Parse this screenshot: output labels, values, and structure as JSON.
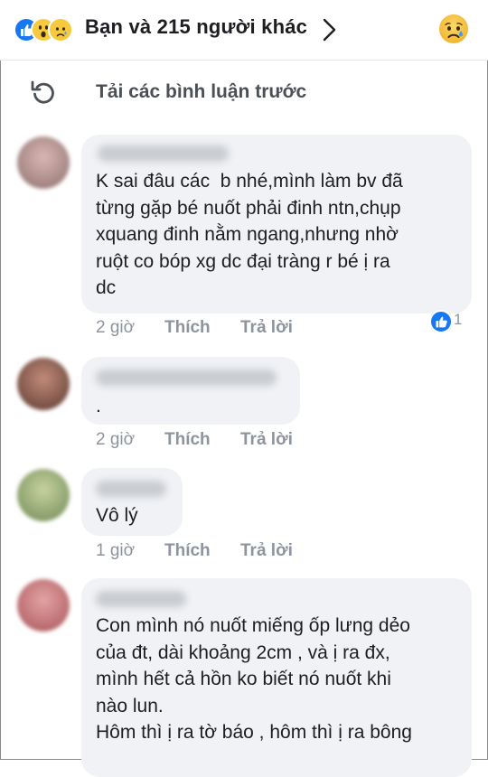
{
  "header": {
    "reaction_icons": [
      "like-icon",
      "wow-icon",
      "sad-icon"
    ],
    "summary": "Bạn và 215 người khác",
    "my_reaction_icon": "sad-icon"
  },
  "load_previous": {
    "label": "Tải các bình luận trước",
    "icon": "reload-icon"
  },
  "comments": [
    {
      "text": "K sai đâu các  b nhé,mình làm bv đã\ntừng gặp bé nuốt phải đinh ntn,chụp\nxquang đinh nằm ngang,nhưng nhờ\nruột co bóp xg dc đại tràng r bé ị ra\ndc",
      "time": "2 giờ",
      "like_label": "Thích",
      "reply_label": "Trả lời",
      "like_count": "1"
    },
    {
      "text": ".",
      "time": "2 giờ",
      "like_label": "Thích",
      "reply_label": "Trả lời"
    },
    {
      "text": "Vô lý",
      "time": "1 giờ",
      "like_label": "Thích",
      "reply_label": "Trả lời"
    },
    {
      "text": "Con mình nó nuốt miếng ốp lưng dẻo\ncủa đt, dài khoảng 2cm , và ị ra đx,\nmình hết cả hồn ko biết nó nuốt khi\nnào lun.\nHôm thì ị ra tờ báo , hôm thì ị ra bông"
    }
  ],
  "colors": {
    "like_blue": "#1877f2",
    "bubble_gray": "#f0f2f5",
    "meta_gray": "#8d949e",
    "reaction_yellow": "#f7c93e"
  }
}
